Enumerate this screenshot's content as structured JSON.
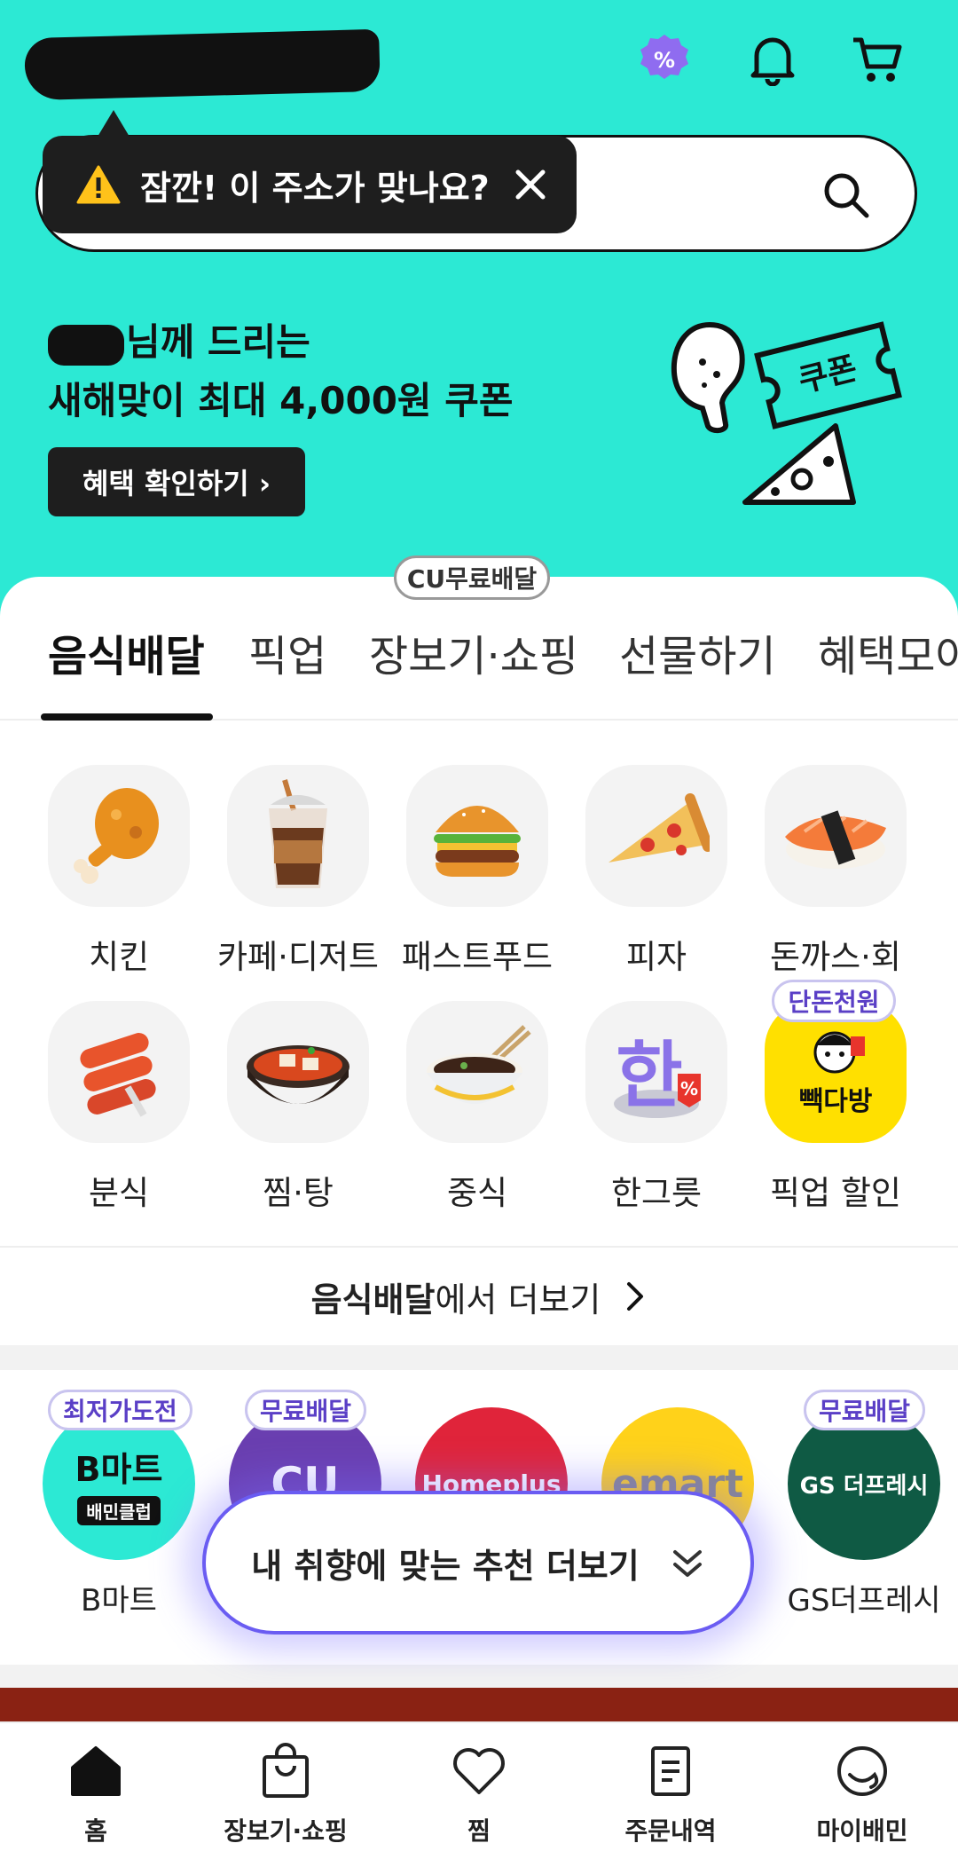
{
  "colors": {
    "header_bg": "#2ce9d4",
    "dark": "#1e1e1e",
    "accent_purple": "#5a3fc6"
  },
  "tooltip": {
    "text": "잠깐! 이 주소가 맞나요?"
  },
  "promo": {
    "line1_suffix": "님께 드리는",
    "line2": "새해맞이 최대 4,000원 쿠폰",
    "button": "혜택 확인하기 ›",
    "sticker": "쿠폰"
  },
  "cu_badge": "CU무료배달",
  "tabs": [
    "음식배달",
    "픽업",
    "장보기·쇼핑",
    "선물하기",
    "혜택모아"
  ],
  "categories": [
    {
      "label": "치킨",
      "icon": "chicken-icon"
    },
    {
      "label": "카페·디저트",
      "icon": "coffee-icon"
    },
    {
      "label": "패스트푸드",
      "icon": "burger-icon"
    },
    {
      "label": "피자",
      "icon": "pizza-icon"
    },
    {
      "label": "돈까스·회",
      "icon": "sushi-icon"
    },
    {
      "label": "분식",
      "icon": "tteokbokki-icon"
    },
    {
      "label": "찜·탕",
      "icon": "stew-icon"
    },
    {
      "label": "중식",
      "icon": "noodle-icon"
    },
    {
      "label": "한그릇",
      "icon": "han-bowl-icon"
    },
    {
      "label": "픽업 할인",
      "icon": "paik-icon"
    }
  ],
  "pickup_badge": "단돈천원",
  "paik_logo": "빽다방",
  "han_char": "한",
  "more": {
    "bold": "음식배달",
    "rest": "에서 더보기"
  },
  "stores": [
    {
      "label": "B마트",
      "badge": "최저가도전",
      "logo": "B마트",
      "sub": "배민클럽"
    },
    {
      "label": "",
      "badge": "무료배달",
      "logo": "CU"
    },
    {
      "label": "",
      "badge": "",
      "logo": "Homeplus"
    },
    {
      "label": "",
      "badge": "",
      "logo": "emart"
    },
    {
      "label": "GS더프레시",
      "badge": "무료배달",
      "logo": "GS 더프레시"
    }
  ],
  "recommend": "내 취향에 맞는 추천 더보기",
  "nav": [
    "홈",
    "장보기·쇼핑",
    "찜",
    "주문내역",
    "마이배민"
  ]
}
